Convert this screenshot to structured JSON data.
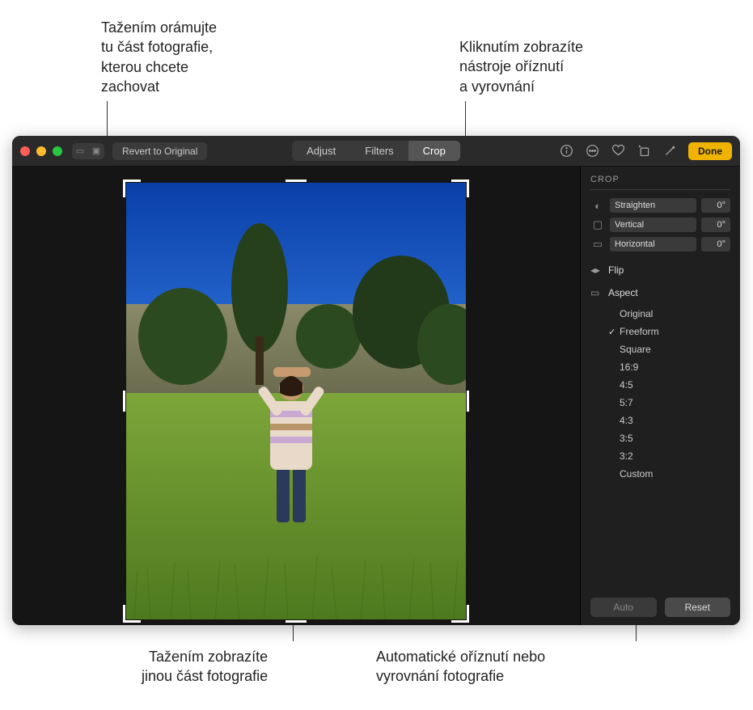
{
  "callouts": {
    "top_left": "Tažením orámujte\ntu část fotografie,\nkterou chcete\nzachovat",
    "top_right": "Kliknutím zobrazíte\nnástroje oříznutí\na vyrovnání",
    "bottom_left": "Tažením zobrazíte\njinou část fotografie",
    "bottom_right": "Automatické oříznutí nebo\nvyrovnání fotografie"
  },
  "toolbar": {
    "revert_label": "Revert to Original",
    "tabs": {
      "adjust": "Adjust",
      "filters": "Filters",
      "crop": "Crop"
    },
    "done_label": "Done"
  },
  "panel": {
    "title": "CROP",
    "sliders": {
      "straighten": {
        "label": "Straighten",
        "value": "0°"
      },
      "vertical": {
        "label": "Vertical",
        "value": "0°"
      },
      "horizontal": {
        "label": "Horizontal",
        "value": "0°"
      }
    },
    "flip_label": "Flip",
    "aspect_label": "Aspect",
    "aspect_options": [
      {
        "label": "Original",
        "selected": false
      },
      {
        "label": "Freeform",
        "selected": true
      },
      {
        "label": "Square",
        "selected": false
      },
      {
        "label": "16:9",
        "selected": false
      },
      {
        "label": "4:5",
        "selected": false
      },
      {
        "label": "5:7",
        "selected": false
      },
      {
        "label": "4:3",
        "selected": false
      },
      {
        "label": "3:5",
        "selected": false
      },
      {
        "label": "3:2",
        "selected": false
      },
      {
        "label": "Custom",
        "selected": false
      }
    ],
    "footer": {
      "auto": "Auto",
      "reset": "Reset"
    }
  }
}
